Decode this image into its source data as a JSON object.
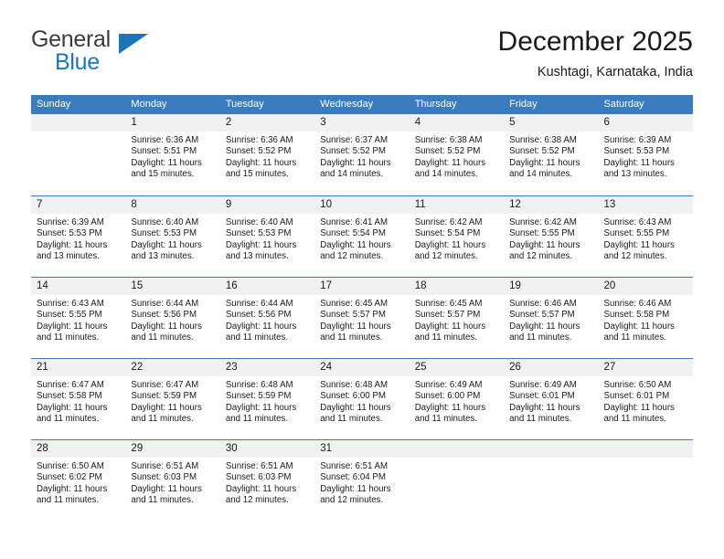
{
  "brand": {
    "name_top": "General",
    "name_bottom": "Blue",
    "triangle_icon": "triangle-icon",
    "color_dark": "#3b3b3b",
    "color_blue": "#1b75bb"
  },
  "header": {
    "title": "December 2025",
    "location": "Kushtagi, Karnataka, India"
  },
  "calendar": {
    "header_bg": "#3a7cbe",
    "day_band_bg": "#f1f1f1",
    "weekdays": [
      "Sunday",
      "Monday",
      "Tuesday",
      "Wednesday",
      "Thursday",
      "Friday",
      "Saturday"
    ],
    "weeks": [
      [
        {
          "day": "",
          "sunrise": "",
          "sunset": "",
          "daylight": "",
          "empty": true
        },
        {
          "day": "1",
          "sunrise": "Sunrise: 6:36 AM",
          "sunset": "Sunset: 5:51 PM",
          "daylight": "Daylight: 11 hours and 15 minutes."
        },
        {
          "day": "2",
          "sunrise": "Sunrise: 6:36 AM",
          "sunset": "Sunset: 5:52 PM",
          "daylight": "Daylight: 11 hours and 15 minutes."
        },
        {
          "day": "3",
          "sunrise": "Sunrise: 6:37 AM",
          "sunset": "Sunset: 5:52 PM",
          "daylight": "Daylight: 11 hours and 14 minutes."
        },
        {
          "day": "4",
          "sunrise": "Sunrise: 6:38 AM",
          "sunset": "Sunset: 5:52 PM",
          "daylight": "Daylight: 11 hours and 14 minutes."
        },
        {
          "day": "5",
          "sunrise": "Sunrise: 6:38 AM",
          "sunset": "Sunset: 5:52 PM",
          "daylight": "Daylight: 11 hours and 14 minutes."
        },
        {
          "day": "6",
          "sunrise": "Sunrise: 6:39 AM",
          "sunset": "Sunset: 5:53 PM",
          "daylight": "Daylight: 11 hours and 13 minutes."
        }
      ],
      [
        {
          "day": "7",
          "sunrise": "Sunrise: 6:39 AM",
          "sunset": "Sunset: 5:53 PM",
          "daylight": "Daylight: 11 hours and 13 minutes."
        },
        {
          "day": "8",
          "sunrise": "Sunrise: 6:40 AM",
          "sunset": "Sunset: 5:53 PM",
          "daylight": "Daylight: 11 hours and 13 minutes."
        },
        {
          "day": "9",
          "sunrise": "Sunrise: 6:40 AM",
          "sunset": "Sunset: 5:53 PM",
          "daylight": "Daylight: 11 hours and 13 minutes."
        },
        {
          "day": "10",
          "sunrise": "Sunrise: 6:41 AM",
          "sunset": "Sunset: 5:54 PM",
          "daylight": "Daylight: 11 hours and 12 minutes."
        },
        {
          "day": "11",
          "sunrise": "Sunrise: 6:42 AM",
          "sunset": "Sunset: 5:54 PM",
          "daylight": "Daylight: 11 hours and 12 minutes."
        },
        {
          "day": "12",
          "sunrise": "Sunrise: 6:42 AM",
          "sunset": "Sunset: 5:55 PM",
          "daylight": "Daylight: 11 hours and 12 minutes."
        },
        {
          "day": "13",
          "sunrise": "Sunrise: 6:43 AM",
          "sunset": "Sunset: 5:55 PM",
          "daylight": "Daylight: 11 hours and 12 minutes."
        }
      ],
      [
        {
          "day": "14",
          "sunrise": "Sunrise: 6:43 AM",
          "sunset": "Sunset: 5:55 PM",
          "daylight": "Daylight: 11 hours and 11 minutes."
        },
        {
          "day": "15",
          "sunrise": "Sunrise: 6:44 AM",
          "sunset": "Sunset: 5:56 PM",
          "daylight": "Daylight: 11 hours and 11 minutes."
        },
        {
          "day": "16",
          "sunrise": "Sunrise: 6:44 AM",
          "sunset": "Sunset: 5:56 PM",
          "daylight": "Daylight: 11 hours and 11 minutes."
        },
        {
          "day": "17",
          "sunrise": "Sunrise: 6:45 AM",
          "sunset": "Sunset: 5:57 PM",
          "daylight": "Daylight: 11 hours and 11 minutes."
        },
        {
          "day": "18",
          "sunrise": "Sunrise: 6:45 AM",
          "sunset": "Sunset: 5:57 PM",
          "daylight": "Daylight: 11 hours and 11 minutes."
        },
        {
          "day": "19",
          "sunrise": "Sunrise: 6:46 AM",
          "sunset": "Sunset: 5:57 PM",
          "daylight": "Daylight: 11 hours and 11 minutes."
        },
        {
          "day": "20",
          "sunrise": "Sunrise: 6:46 AM",
          "sunset": "Sunset: 5:58 PM",
          "daylight": "Daylight: 11 hours and 11 minutes."
        }
      ],
      [
        {
          "day": "21",
          "sunrise": "Sunrise: 6:47 AM",
          "sunset": "Sunset: 5:58 PM",
          "daylight": "Daylight: 11 hours and 11 minutes."
        },
        {
          "day": "22",
          "sunrise": "Sunrise: 6:47 AM",
          "sunset": "Sunset: 5:59 PM",
          "daylight": "Daylight: 11 hours and 11 minutes."
        },
        {
          "day": "23",
          "sunrise": "Sunrise: 6:48 AM",
          "sunset": "Sunset: 5:59 PM",
          "daylight": "Daylight: 11 hours and 11 minutes."
        },
        {
          "day": "24",
          "sunrise": "Sunrise: 6:48 AM",
          "sunset": "Sunset: 6:00 PM",
          "daylight": "Daylight: 11 hours and 11 minutes."
        },
        {
          "day": "25",
          "sunrise": "Sunrise: 6:49 AM",
          "sunset": "Sunset: 6:00 PM",
          "daylight": "Daylight: 11 hours and 11 minutes."
        },
        {
          "day": "26",
          "sunrise": "Sunrise: 6:49 AM",
          "sunset": "Sunset: 6:01 PM",
          "daylight": "Daylight: 11 hours and 11 minutes."
        },
        {
          "day": "27",
          "sunrise": "Sunrise: 6:50 AM",
          "sunset": "Sunset: 6:01 PM",
          "daylight": "Daylight: 11 hours and 11 minutes."
        }
      ],
      [
        {
          "day": "28",
          "sunrise": "Sunrise: 6:50 AM",
          "sunset": "Sunset: 6:02 PM",
          "daylight": "Daylight: 11 hours and 11 minutes."
        },
        {
          "day": "29",
          "sunrise": "Sunrise: 6:51 AM",
          "sunset": "Sunset: 6:03 PM",
          "daylight": "Daylight: 11 hours and 11 minutes."
        },
        {
          "day": "30",
          "sunrise": "Sunrise: 6:51 AM",
          "sunset": "Sunset: 6:03 PM",
          "daylight": "Daylight: 11 hours and 12 minutes."
        },
        {
          "day": "31",
          "sunrise": "Sunrise: 6:51 AM",
          "sunset": "Sunset: 6:04 PM",
          "daylight": "Daylight: 11 hours and 12 minutes."
        },
        {
          "day": "",
          "sunrise": "",
          "sunset": "",
          "daylight": "",
          "empty": true
        },
        {
          "day": "",
          "sunrise": "",
          "sunset": "",
          "daylight": "",
          "empty": true
        },
        {
          "day": "",
          "sunrise": "",
          "sunset": "",
          "daylight": "",
          "empty": true
        }
      ]
    ]
  }
}
